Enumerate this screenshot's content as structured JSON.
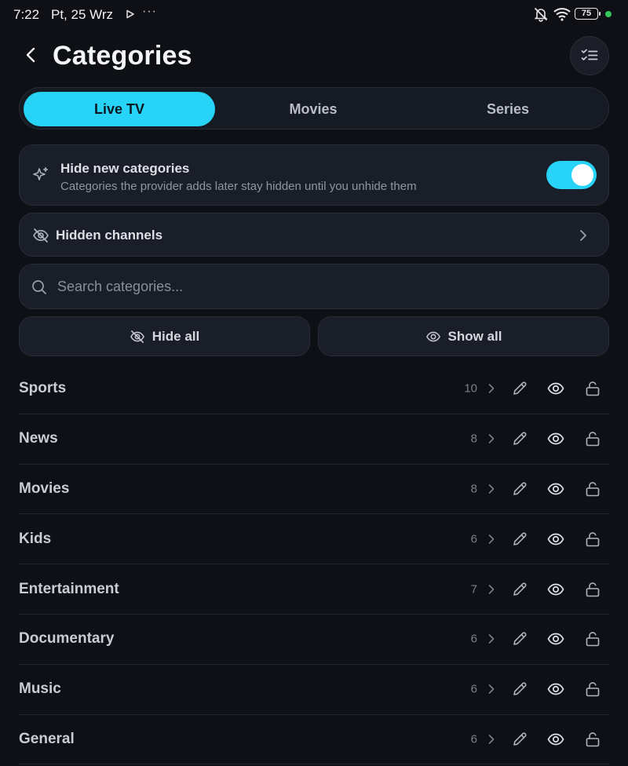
{
  "status_bar": {
    "time": "7:22",
    "date": "Pt, 25 Wrz",
    "more": "···",
    "battery_level": "75",
    "indicator_color": "#34c759"
  },
  "header": {
    "title": "Categories",
    "back_icon": "back-arrow-icon",
    "multi_select_icon": "checklist-icon"
  },
  "tabs": [
    {
      "label": "Live TV",
      "active": true
    },
    {
      "label": "Movies",
      "active": false
    },
    {
      "label": "Series",
      "active": false
    }
  ],
  "hide_new": {
    "title": "Hide new categories",
    "description": "Categories the provider adds later stay hidden until you unhide them",
    "enabled": true,
    "icon": "sparkle-icon"
  },
  "hidden_channels": {
    "label": "Hidden channels",
    "icon": "eye-off-icon"
  },
  "search": {
    "placeholder": "Search categories..."
  },
  "actions": {
    "hide_all": "Hide all",
    "show_all": "Show all"
  },
  "accent_color": "#27d3f7",
  "categories": [
    {
      "name": "Sports",
      "count": "10"
    },
    {
      "name": "News",
      "count": "8"
    },
    {
      "name": "Movies",
      "count": "8"
    },
    {
      "name": "Kids",
      "count": "6"
    },
    {
      "name": "Entertainment",
      "count": "7"
    },
    {
      "name": "Documentary",
      "count": "6"
    },
    {
      "name": "Music",
      "count": "6"
    },
    {
      "name": "General",
      "count": "6"
    }
  ]
}
